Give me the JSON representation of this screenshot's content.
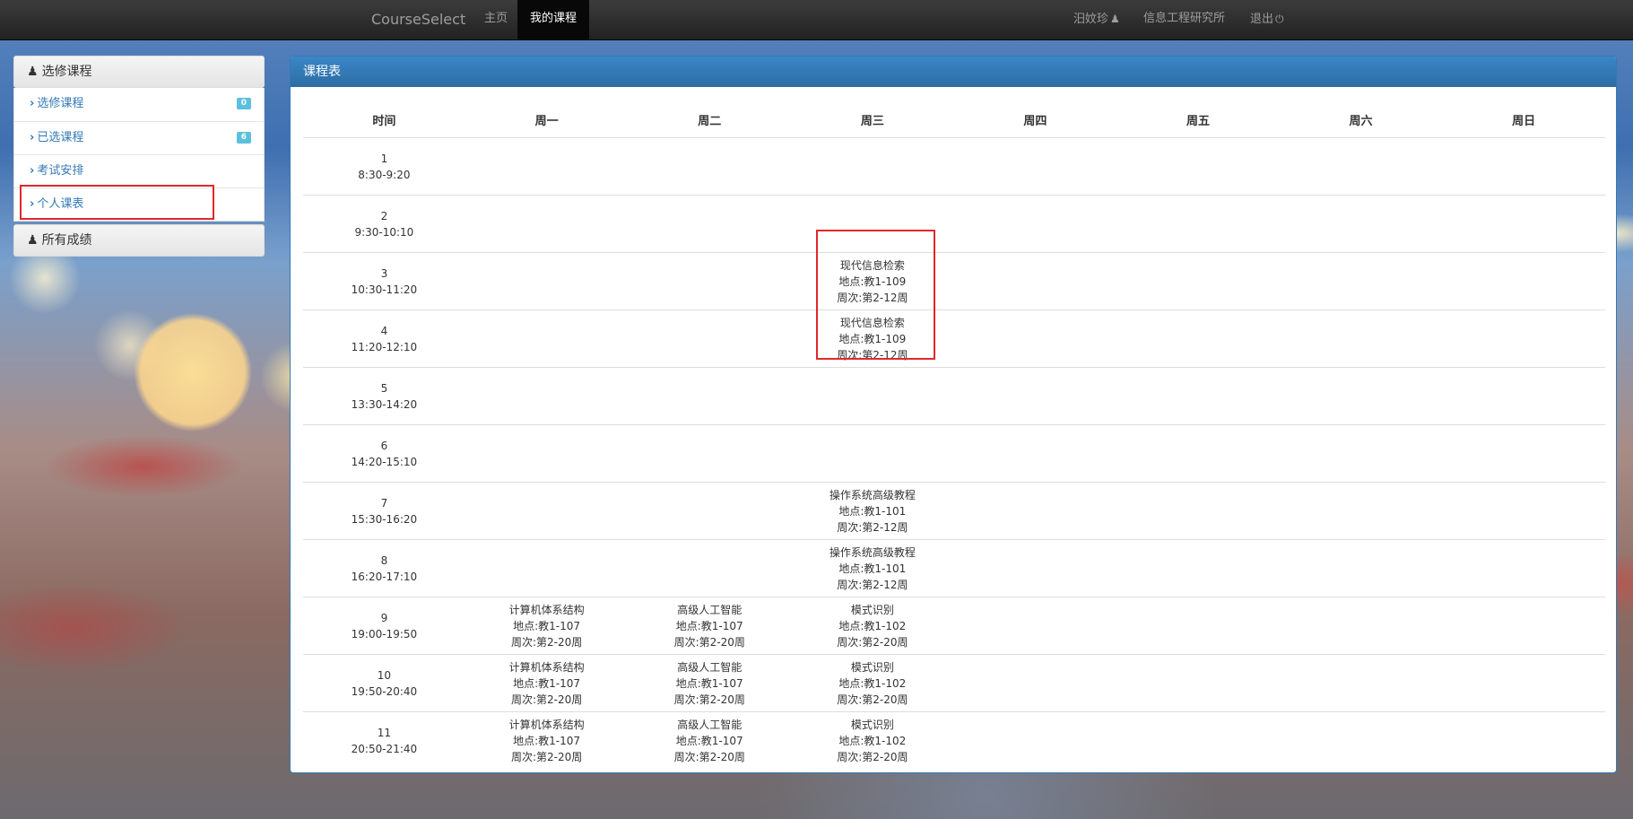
{
  "navbar": {
    "brand": "CourseSelect",
    "home": "主页",
    "my_courses": "我的课程",
    "user_name": "汨妏珍",
    "department": "信息工程研究所",
    "logout": "退出"
  },
  "sidebar": {
    "section1_title": "选修课程",
    "items": [
      {
        "label": "选修课程",
        "badge": "0"
      },
      {
        "label": "已选课程",
        "badge": "6"
      },
      {
        "label": "考试安排"
      },
      {
        "label": "个人课表"
      }
    ],
    "section2_title": "所有成绩"
  },
  "schedule": {
    "title": "课程表",
    "headers": [
      "时间",
      "周一",
      "周二",
      "周三",
      "周四",
      "周五",
      "周六",
      "周日"
    ],
    "rows": [
      {
        "period": "1",
        "time": "8:30-9:20",
        "cells": [
          "",
          "",
          "",
          "",
          "",
          "",
          ""
        ]
      },
      {
        "period": "2",
        "time": "9:30-10:10",
        "cells": [
          "",
          "",
          "",
          "",
          "",
          "",
          ""
        ]
      },
      {
        "period": "3",
        "time": "10:30-11:20",
        "cells": [
          "",
          "",
          "现代信息检索\n地点:教1-109\n周次:第2-12周",
          "",
          "",
          "",
          ""
        ]
      },
      {
        "period": "4",
        "time": "11:20-12:10",
        "cells": [
          "",
          "",
          "现代信息检索\n地点:教1-109\n周次:第2-12周",
          "",
          "",
          "",
          ""
        ]
      },
      {
        "period": "5",
        "time": "13:30-14:20",
        "cells": [
          "",
          "",
          "",
          "",
          "",
          "",
          ""
        ]
      },
      {
        "period": "6",
        "time": "14:20-15:10",
        "cells": [
          "",
          "",
          "",
          "",
          "",
          "",
          ""
        ]
      },
      {
        "period": "7",
        "time": "15:30-16:20",
        "cells": [
          "",
          "",
          "操作系统高级教程\n地点:教1-101\n周次:第2-12周",
          "",
          "",
          "",
          ""
        ]
      },
      {
        "period": "8",
        "time": "16:20-17:10",
        "cells": [
          "",
          "",
          "操作系统高级教程\n地点:教1-101\n周次:第2-12周",
          "",
          "",
          "",
          ""
        ]
      },
      {
        "period": "9",
        "time": "19:00-19:50",
        "cells": [
          "计算机体系结构\n地点:教1-107\n周次:第2-20周",
          "高级人工智能\n地点:教1-107\n周次:第2-20周",
          "模式识别\n地点:教1-102\n周次:第2-20周",
          "",
          "",
          "",
          ""
        ]
      },
      {
        "period": "10",
        "time": "19:50-20:40",
        "cells": [
          "计算机体系结构\n地点:教1-107\n周次:第2-20周",
          "高级人工智能\n地点:教1-107\n周次:第2-20周",
          "模式识别\n地点:教1-102\n周次:第2-20周",
          "",
          "",
          "",
          ""
        ]
      },
      {
        "period": "11",
        "time": "20:50-21:40",
        "cells": [
          "计算机体系结构\n地点:教1-107\n周次:第2-20周",
          "高级人工智能\n地点:教1-107\n周次:第2-20周",
          "模式识别\n地点:教1-102\n周次:第2-20周",
          "",
          "",
          "",
          ""
        ]
      }
    ]
  }
}
